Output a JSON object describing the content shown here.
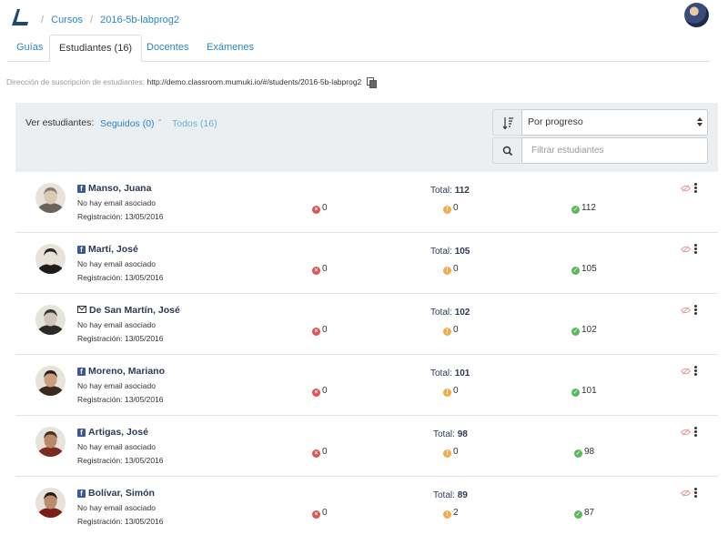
{
  "breadcrumb": {
    "items": [
      "Cursos",
      "2016-5b-labprog2"
    ],
    "separator": "/"
  },
  "tabs": [
    {
      "label": "Guías",
      "active": false
    },
    {
      "label": "Estudiantes (16)",
      "active": true
    },
    {
      "label": "Docentes",
      "active": false
    },
    {
      "label": "Exámenes",
      "active": false
    }
  ],
  "subscription": {
    "label": "Dirección de suscripción de estudiantes:",
    "url": "http://demo.classroom.mumuki.io/#/students/2016-5b-labprog2"
  },
  "filters": {
    "label": "Ver estudiantes:",
    "followed": "Seguidos (0)",
    "dash": "-",
    "all": "Todos (16)"
  },
  "sort": {
    "selected": "Por progreso"
  },
  "search": {
    "placeholder": "Filtrar estudiantes"
  },
  "students": [
    {
      "name": "Manso, Juana",
      "account": "facebook",
      "email": "No hay email asociado",
      "registered": "Registración: 13/05/2016",
      "total_label": "Total:",
      "total": "112",
      "failed": "0",
      "passed_with_warnings": "0",
      "passed": "112"
    },
    {
      "name": "Martí, José",
      "account": "facebook",
      "email": "No hay email asociado",
      "registered": "Registración: 13/05/2016",
      "total_label": "Total:",
      "total": "105",
      "failed": "0",
      "passed_with_warnings": "0",
      "passed": "105"
    },
    {
      "name": "De San Martín, José",
      "account": "email",
      "email": "No hay email asociado",
      "registered": "Registración: 13/05/2016",
      "total_label": "Total:",
      "total": "102",
      "failed": "0",
      "passed_with_warnings": "0",
      "passed": "102"
    },
    {
      "name": "Moreno, Mariano",
      "account": "facebook",
      "email": "No hay email asociado",
      "registered": "Registración: 13/05/2016",
      "total_label": "Total:",
      "total": "101",
      "failed": "0",
      "passed_with_warnings": "0",
      "passed": "101"
    },
    {
      "name": "Artigas, José",
      "account": "facebook",
      "email": "No hay email asociado",
      "registered": "Registración: 13/05/2016",
      "total_label": "Total:",
      "total": "98",
      "failed": "0",
      "passed_with_warnings": "0",
      "passed": "98"
    },
    {
      "name": "Bolívar, Simón",
      "account": "facebook",
      "email": "No hay email asociado",
      "registered": "Registración: 13/05/2016",
      "total_label": "Total:",
      "total": "89",
      "failed": "0",
      "passed_with_warnings": "2",
      "passed": "87"
    }
  ],
  "colors": {
    "link": "#2a86c9",
    "panel_header": "#eceff1",
    "failed": "#e05350",
    "warning": "#f0ad4e",
    "passed": "#5cb85c",
    "facebook": "#3b5998"
  },
  "icons": {
    "logo": "mumuki-logo-icon",
    "copy": "copy-icon",
    "sort": "sort-icon",
    "search": "search-icon",
    "facebook": "facebook-icon",
    "email": "envelope-icon",
    "failed": "times-circle-icon",
    "warning": "exclamation-circle-icon",
    "passed": "check-circle-icon",
    "hide": "eye-slash-icon",
    "menu": "vertical-ellipsis-icon"
  }
}
